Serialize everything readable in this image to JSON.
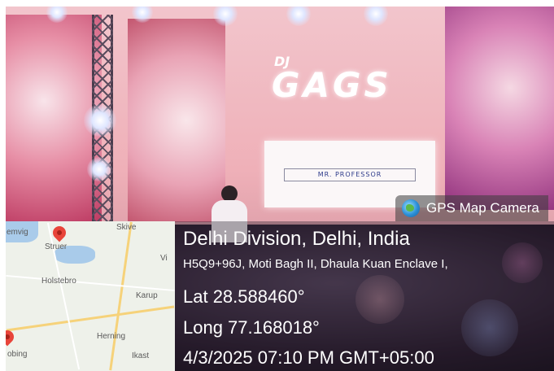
{
  "photo": {
    "logo_text": "GAGS",
    "logo_prefix": "DJ",
    "board_text": "MR. PROFESSOR"
  },
  "badge": {
    "icon": "globe-icon",
    "label": "GPS Map Camera"
  },
  "map": {
    "places": [
      "Skive",
      "emvig",
      "Struer",
      "Holstebro",
      "Vi",
      "Karup",
      "Herning",
      "Ikast",
      "obing"
    ]
  },
  "location": {
    "title": "Delhi Division, Delhi, India",
    "address": "H5Q9+96J, Moti Bagh II, Dhaula Kuan Enclave I,",
    "lat": "Lat 28.588460°",
    "long": "Long 77.168018°",
    "datetime": "4/3/2025 07:10 PM GMT+05:00"
  }
}
